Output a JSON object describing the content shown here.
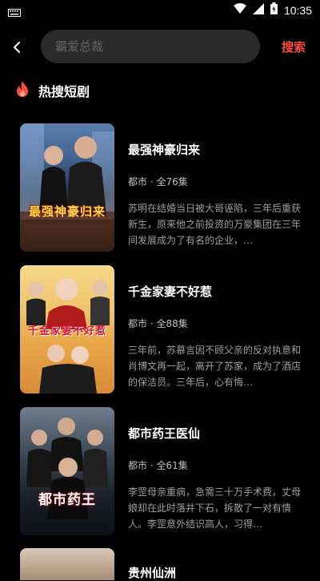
{
  "status_bar": {
    "time": "10:35"
  },
  "header": {
    "search_placeholder": "霸爱总裁",
    "search_button": "搜索"
  },
  "section": {
    "title": "热搜短剧"
  },
  "dramas": [
    {
      "title": "最强神豪归来",
      "poster_title": "最强神豪归来",
      "meta": "都市 · 全76集",
      "desc": "苏明在结婚当日被大哥诬陷，三年后重获新生，原来他之前投资的万豪集团在三年间发展成为了有名的企业，…"
    },
    {
      "title": "千金家妻不好惹",
      "poster_title": "千金家妻不好惹",
      "meta": "都市 · 全88集",
      "desc": "三年前，苏慕言因不顾父亲的反对执意和肖博文再一起，离开了苏家，成为了酒店的保洁员。三年后，心有悔…"
    },
    {
      "title": "都市药王医仙",
      "poster_title": "都市药王",
      "meta": "都市 · 全61集",
      "desc": "李罡母亲重病，急需三十万手术费，丈母娘却在此时落井下石，拆散了一对有情人。李罡意外结识高人，习得…"
    }
  ],
  "partial_item": {
    "title": "贵州仙洲"
  },
  "colors": {
    "accent": "#ff4a3d",
    "search_bg": "#2a2a2a",
    "background": "#000000"
  }
}
